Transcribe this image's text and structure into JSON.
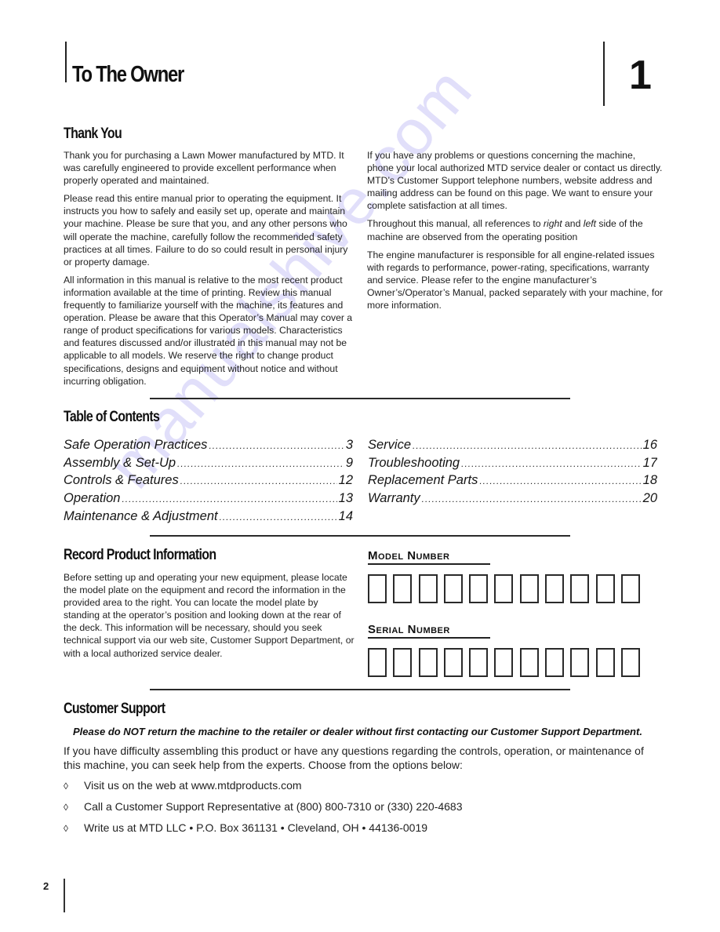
{
  "header": {
    "title": "To The Owner",
    "chapter_number": "1"
  },
  "thank_you": {
    "heading": "Thank You",
    "left_paragraphs": [
      "Thank you for purchasing a Lawn Mower manufactured by MTD. It was carefully engineered to provide excellent performance when properly operated and maintained.",
      "Please read this entire manual prior to operating the equipment. It instructs you how to safely and easily set up, operate and maintain your machine.  Please be sure that you, and any other persons who will operate the machine, carefully follow the recommended safety practices at all times.  Failure to do so could result in personal injury or property damage.",
      "All information in this manual is relative to the most recent product information available at the time of printing.  Review this manual frequently to familiarize yourself with the machine, its features and operation.  Please be aware that this Operator’s Manual may cover a range of product specifications for various models. Characteristics and features discussed and/or illustrated in this manual may not be applicable to all models. We reserve the right to change product specifications, designs and equipment without notice and without incurring obligation."
    ],
    "right_p1": "If you have any problems or questions concerning the machine, phone your local authorized MTD service dealer or contact us directly.  MTD’s Customer Support telephone numbers, website address and mailing address can be found on this page. We want to ensure your complete satisfaction at all times.",
    "right_p2_pre": "Throughout this manual, all references to ",
    "right_p2_right": "right",
    "right_p2_mid": " and ",
    "right_p2_left": "left",
    "right_p2_post": " side of the machine  are observed from the operating position",
    "right_p3": "The engine manufacturer is responsible for all engine-related issues with regards to performance, power-rating, specifications, warranty and service. Please refer to the engine manufacturer’s Owner’s/Operator’s Manual, packed separately with your machine, for more information."
  },
  "toc": {
    "heading": "Table of Contents",
    "left": [
      {
        "label": "Safe Operation Practices",
        "page": "3"
      },
      {
        "label": "Assembly & Set-Up",
        "page": "9"
      },
      {
        "label": "Controls & Features",
        "page": "12"
      },
      {
        "label": "Operation",
        "page": "13"
      },
      {
        "label": "Maintenance  & Adjustment",
        "page": "14"
      }
    ],
    "right": [
      {
        "label": "Service",
        "page": "16"
      },
      {
        "label": "Troubleshooting",
        "page": "17"
      },
      {
        "label": "Replacement Parts",
        "page": "18"
      },
      {
        "label": "Warranty",
        "page": "20"
      }
    ]
  },
  "record": {
    "heading": "Record Product Information",
    "body": "Before setting up and operating your new equipment, please locate the model plate on the equipment and record the information in the provided area to the right. You can locate the model plate by standing at the operator’s position and looking down at the rear of the deck. This information will be necessary, should you seek technical support via our web site, Customer Support Department, or with a local authorized service dealer.",
    "model_label": "Model Number",
    "serial_label": "Serial Number",
    "model_box_count": 11,
    "serial_box_count": 11
  },
  "support": {
    "heading": "Customer Support",
    "warning": "Please do NOT return the machine to the retailer or dealer without first contacting our Customer Support Department.",
    "intro": "If you have difficulty assembling this product or have any questions regarding the controls, operation, or maintenance of this machine, you can seek help from the experts. Choose from the options below:",
    "bullet_icon": "◊",
    "items": [
      "Visit us on the web at www.mtdproducts.com",
      "Call a Customer Support Representative at (800) 800-7310 or (330) 220-4683",
      "Write us at MTD LLC • P.O. Box 361131 • Cleveland, OH • 44136-0019"
    ]
  },
  "footer": {
    "page_number": "2"
  },
  "watermark": "manualshive.com"
}
